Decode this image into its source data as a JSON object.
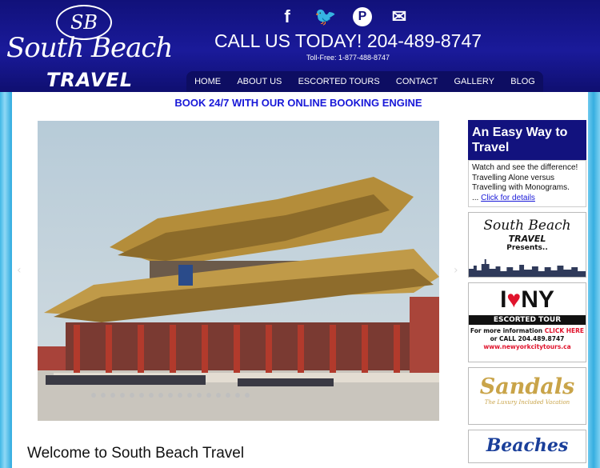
{
  "logo": {
    "monogram": "SB",
    "name": "South Beach",
    "sub": "TRAVEL"
  },
  "social": [
    {
      "icon": "facebook-icon",
      "glyph": "f"
    },
    {
      "icon": "twitter-icon",
      "glyph": "🐦"
    },
    {
      "icon": "pinterest-icon",
      "glyph": "P"
    },
    {
      "icon": "email-icon",
      "glyph": "✉"
    }
  ],
  "contact": {
    "call": "CALL US TODAY! 204-489-8747",
    "tollfree": "Toll-Free: 1-877-488-8747"
  },
  "nav": [
    "HOME",
    "ABOUT US",
    "ESCORTED TOURS",
    "CONTACT",
    "GALLERY",
    "BLOG"
  ],
  "booking": "BOOK 24/7 WITH OUR ONLINE BOOKING ENGINE",
  "welcome": "Welcome to South Beach Travel",
  "sidebar": {
    "heading": "An Easy Way to Travel",
    "line1": "Watch and see the difference!",
    "line2": "Travelling Alone versus Travelling with Monograms.",
    "ellipsis": " ... ",
    "link": "Click for details",
    "sb_title": "South Beach",
    "sb_travel": "TRAVEL",
    "sb_presents": "Presents..",
    "ny_i": "I",
    "ny_heart": "♥",
    "ny_ny": "NY",
    "ny_bar": "ESCORTED TOUR",
    "ny_info": "For more information",
    "ny_click": "CLICK HERE",
    "ny_call": "or CALL 204.489.8747",
    "ny_url": "www.newyorkcitytours.ca",
    "sandals": "Sandals",
    "sandals_tag": "The Luxury Included Vacation",
    "beaches": "Beaches"
  },
  "colors": {
    "navy": "#12127e",
    "link": "#1a1ad8",
    "accent_red": "#e0132c"
  }
}
